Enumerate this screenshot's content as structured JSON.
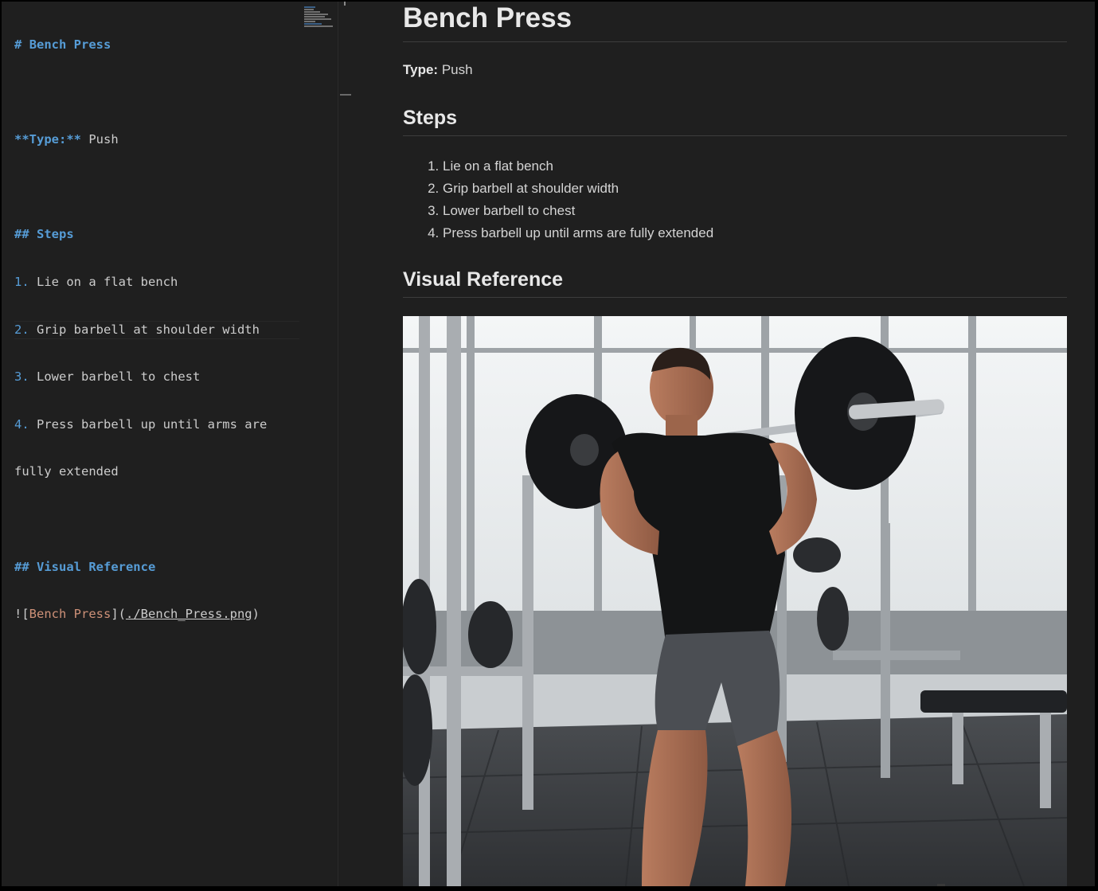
{
  "editor": {
    "lines": {
      "title_hash": "#",
      "title_text": "Bench Press",
      "type_marker": "**Type:**",
      "type_value": "Push",
      "steps_heading": "## Steps",
      "step1_num": "1.",
      "step1_text": "Lie on a flat bench",
      "step2_num": "2.",
      "step2_text": "Grip barbell at shoulder width",
      "step3_num": "3.",
      "step3_text": "Lower barbell to chest",
      "step4_num": "4.",
      "step4_text": "Press barbell up until arms are",
      "step4_cont": "fully extended",
      "visual_heading": "## Visual Reference",
      "img_bang": "![",
      "img_alt": "Bench Press",
      "img_mid": "](",
      "img_path": "./Bench_Press.png",
      "img_close": ")"
    }
  },
  "preview": {
    "title": "Bench Press",
    "type_label": "Type:",
    "type_value": "Push",
    "steps_heading": "Steps",
    "steps": [
      "Lie on a flat bench",
      "Grip barbell at shoulder width",
      "Lower barbell to chest",
      "Press barbell up until arms are fully extended"
    ],
    "visual_heading": "Visual Reference",
    "image_alt": "Bench Press"
  },
  "colors": {
    "background": "#1f1f1f",
    "markdown_keyword": "#569cd6",
    "link_alt": "#ce9178",
    "text": "#d4d4d4"
  }
}
